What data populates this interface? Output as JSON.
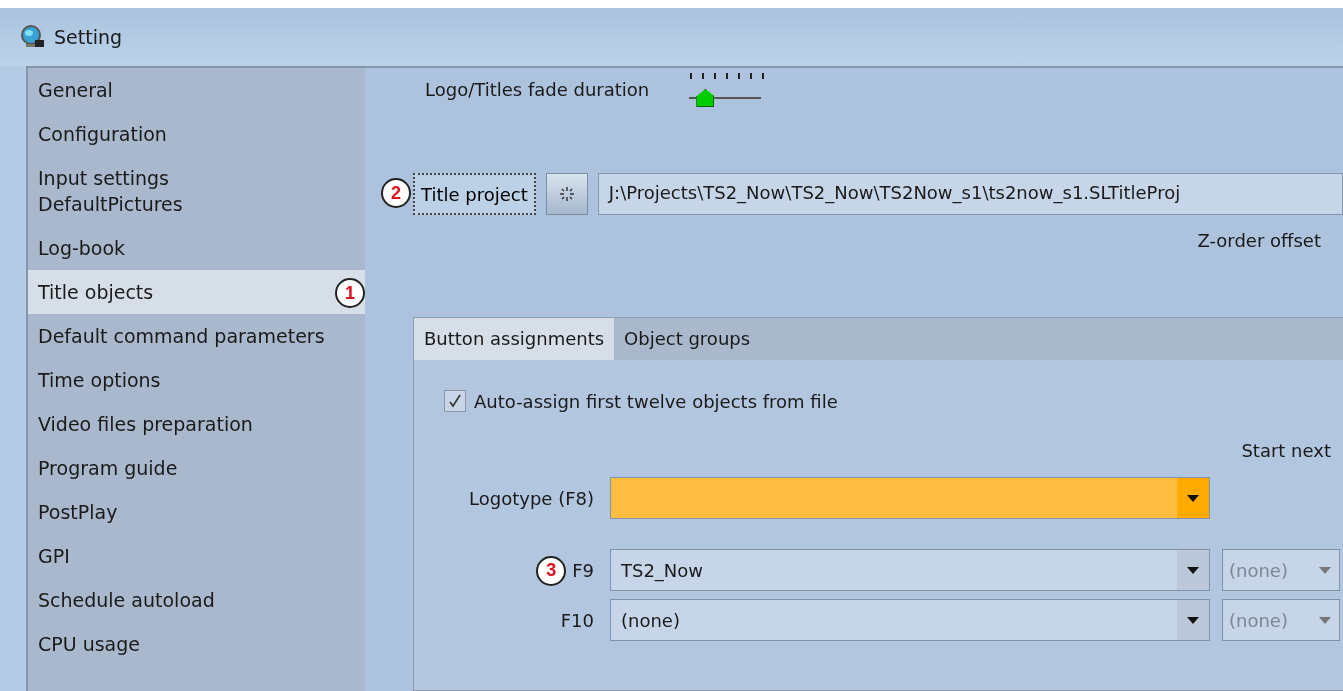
{
  "window": {
    "title": "Setting"
  },
  "sidebar": {
    "items": [
      {
        "label": "General",
        "selected": false
      },
      {
        "label": "Configuration",
        "selected": false
      },
      {
        "label": "Input settings\nDefaultPictures",
        "selected": false
      },
      {
        "label": "Log-book",
        "selected": false
      },
      {
        "label": "Title objects",
        "selected": true,
        "callout": "1"
      },
      {
        "label": "Default command parameters",
        "selected": false
      },
      {
        "label": "Time options",
        "selected": false
      },
      {
        "label": "Video files preparation",
        "selected": false
      },
      {
        "label": "Program guide",
        "selected": false
      },
      {
        "label": "PostPlay",
        "selected": false
      },
      {
        "label": "GPI",
        "selected": false
      },
      {
        "label": "Schedule autoload",
        "selected": false
      },
      {
        "label": "CPU usage",
        "selected": false
      }
    ]
  },
  "fade": {
    "label": "Logo/Titles fade duration",
    "level": 0.12
  },
  "title_project": {
    "button": "Title project",
    "callout": "2",
    "path": "J:\\Projects\\TS2_Now\\TS2_Now\\TS2Now_s1\\ts2now_s1.SLTitleProj"
  },
  "z_order_label": "Z-order offset",
  "tabs": [
    {
      "label": "Button assignments",
      "selected": true
    },
    {
      "label": "Object groups",
      "selected": false
    }
  ],
  "auto_assign": {
    "label": "Auto-assign first twelve objects from file",
    "checked": true
  },
  "start_next_label": "Start next",
  "logotype": {
    "label": "Logotype (F8)"
  },
  "assignments": [
    {
      "key": "F9",
      "callout": "3",
      "value": "TS2_Now",
      "start_next": "(none)"
    },
    {
      "key": "F10",
      "value": "(none)",
      "start_next": "(none)"
    }
  ]
}
